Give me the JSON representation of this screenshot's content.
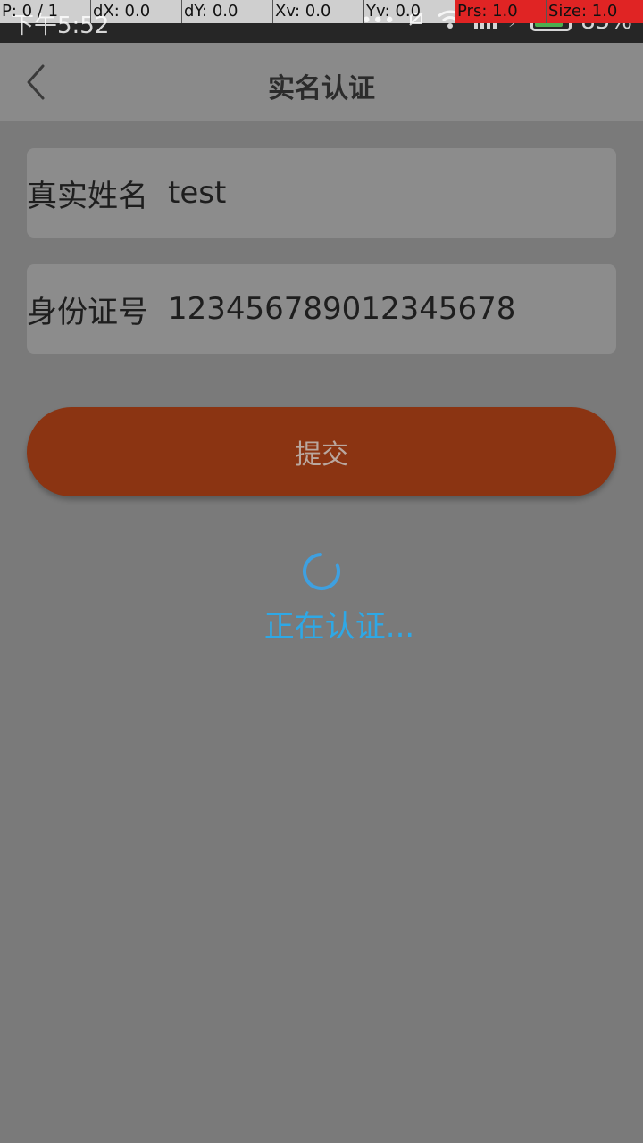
{
  "status_bar": {
    "time": "下午5:52",
    "battery_percent": "85%",
    "battery_level": 0.85
  },
  "debug_overlay": {
    "pointer": "P: 0 / 1",
    "dx": "dX: 0.0",
    "dy": "dY: 0.0",
    "xv": "Xv: 0.0",
    "yv": "Yv: 0.0",
    "prs": "Prs: 1.0",
    "size": "Size: 1.0"
  },
  "header": {
    "title": "实名认证"
  },
  "form": {
    "name_label": "真实姓名",
    "name_value": "test",
    "id_label": "身份证号",
    "id_value": "123456789012345678"
  },
  "actions": {
    "submit_label": "提交"
  },
  "loading": {
    "text": "正在认证..."
  },
  "colors": {
    "accent": "#8b3412",
    "loading": "#2ea8e6"
  }
}
